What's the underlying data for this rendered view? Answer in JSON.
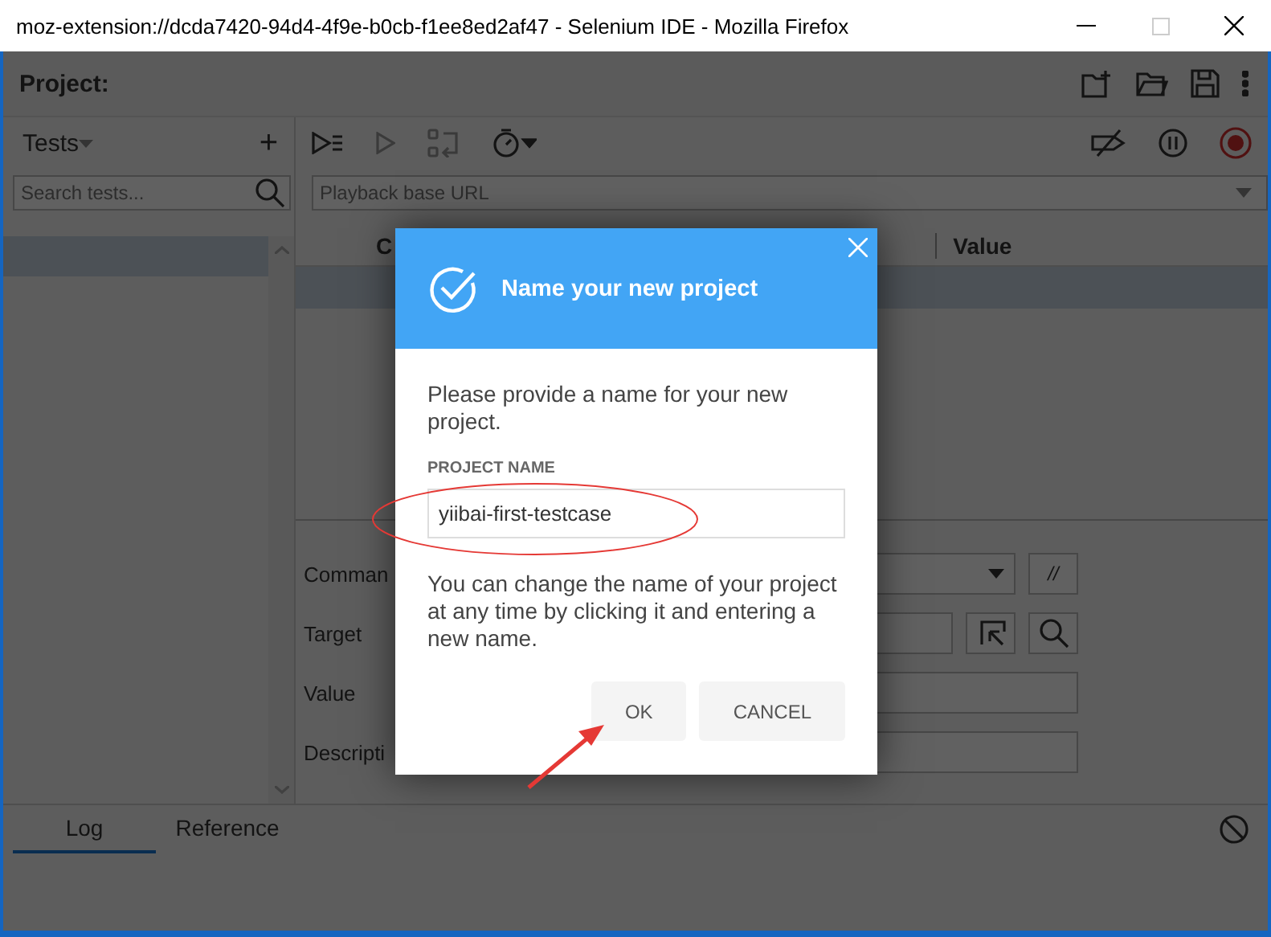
{
  "window": {
    "title": "moz-extension://dcda7420-94d4-4f9e-b0cb-f1ee8ed2af47 - Selenium IDE - Mozilla Firefox"
  },
  "header": {
    "title": "Project:"
  },
  "tests_panel": {
    "title": "Tests",
    "add": "+",
    "search": {
      "placeholder": "Search tests..."
    },
    "rows": [
      {
        "selected": true
      }
    ]
  },
  "url_field": {
    "placeholder": "Playback base URL"
  },
  "table": {
    "columns": [
      "C",
      "Value"
    ],
    "rows": [
      {
        "selected": true
      }
    ]
  },
  "editor": {
    "fields": [
      {
        "label": "Comman",
        "kind": "select"
      },
      {
        "label": "Target",
        "kind": "target"
      },
      {
        "label": "Value",
        "kind": "text"
      },
      {
        "label": "Descripti",
        "kind": "text"
      }
    ],
    "comment_button": "//"
  },
  "bottom_tabs": [
    {
      "label": "Log",
      "selected": true
    },
    {
      "label": "Reference",
      "selected": false
    }
  ],
  "dialog": {
    "title": "Name your new project",
    "message": "Please provide a name for your new project.",
    "field_label": "PROJECT NAME",
    "field_value": "yiibai-first-testcase",
    "note": "You can change the name of your project at any time by clicking it and entering a new name.",
    "buttons": [
      "OK",
      "CANCEL"
    ]
  }
}
